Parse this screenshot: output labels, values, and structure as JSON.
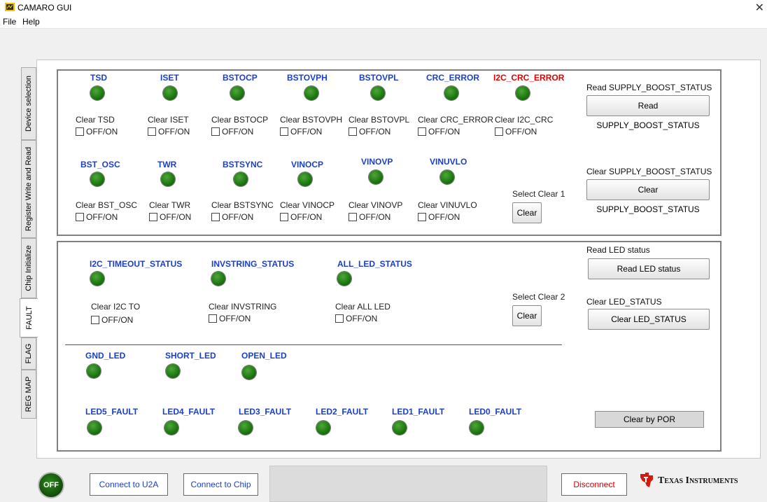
{
  "window": {
    "title": "CAMARO GUI"
  },
  "menu": [
    "File",
    "Help"
  ],
  "tabs": [
    "Device selection",
    "Register Write and Read",
    "Chip Initialize",
    "FAULT",
    "FLAG",
    "REG MAP"
  ],
  "panel1": {
    "row1": [
      {
        "label": "TSD",
        "clear": "Clear TSD"
      },
      {
        "label": "ISET",
        "clear": "Clear ISET"
      },
      {
        "label": "BSTOCP",
        "clear": "Clear BSTOCP"
      },
      {
        "label": "BSTOVPH",
        "clear": "Clear BSTOVPH"
      },
      {
        "label": "BSTOVPL",
        "clear": "Clear BSTOVPL"
      },
      {
        "label": "CRC_ERROR",
        "clear": "Clear CRC_ERROR"
      },
      {
        "label": "I2C_CRC_ERROR",
        "clear": "Clear I2C_CRC",
        "color": "#e00000"
      }
    ],
    "row2": [
      {
        "label": "BST_OSC",
        "clear": "Clear BST_OSC"
      },
      {
        "label": "TWR",
        "clear": "Clear TWR"
      },
      {
        "label": "BSTSYNC",
        "clear": "Clear BSTSYNC"
      },
      {
        "label": "VINOCP",
        "clear": "Clear VINOCP"
      },
      {
        "label": "VINOVP",
        "clear": "Clear VINOVP"
      },
      {
        "label": "VINUVLO",
        "clear": "Clear VINUVLO"
      }
    ],
    "checkbox_label": "OFF/ON",
    "select_clear_label": "Select Clear 1",
    "clear_button": "Clear",
    "read_label": "Read SUPPLY_BOOST_STATUS",
    "read_button": "Read SUPPLY_BOOST_STATUS",
    "clear_status_label": "Clear SUPPLY_BOOST_STATUS",
    "clear_status_button": "Clear SUPPLY_BOOST_STATUS"
  },
  "panel2": {
    "row1": [
      {
        "label": "I2C_TIMEOUT_STATUS",
        "clear": "Clear I2C TO"
      },
      {
        "label": "INVSTRING_STATUS",
        "clear": "Clear INVSTRING"
      },
      {
        "label": "ALL_LED_STATUS",
        "clear": "Clear ALL LED"
      }
    ],
    "checkbox_label": "OFF/ON",
    "select_clear_label": "Select Clear 2",
    "clear_button": "Clear",
    "row2": [
      "GND_LED",
      "SHORT_LED",
      "OPEN_LED"
    ],
    "row3": [
      "LED5_FAULT",
      "LED4_FAULT",
      "LED3_FAULT",
      "LED2_FAULT",
      "LED1_FAULT",
      "LED0_FAULT"
    ],
    "read_led_label": "Read LED status",
    "read_led_button": "Read LED status",
    "clear_led_label": "Clear LED_STATUS",
    "clear_led_button": "Clear LED_STATUS",
    "clear_por_button": "Clear by POR"
  },
  "bottom": {
    "power_led": "OFF",
    "connect_u2a": "Connect to U2A",
    "connect_chip": "Connect to Chip",
    "disconnect": "Disconnect",
    "brand": "Texas Instruments"
  },
  "colors": {
    "indicator_label": "#1a3fd0",
    "error_label": "#e00000",
    "led_on": "#1f7a12",
    "disconnect_text": "#d00000"
  }
}
